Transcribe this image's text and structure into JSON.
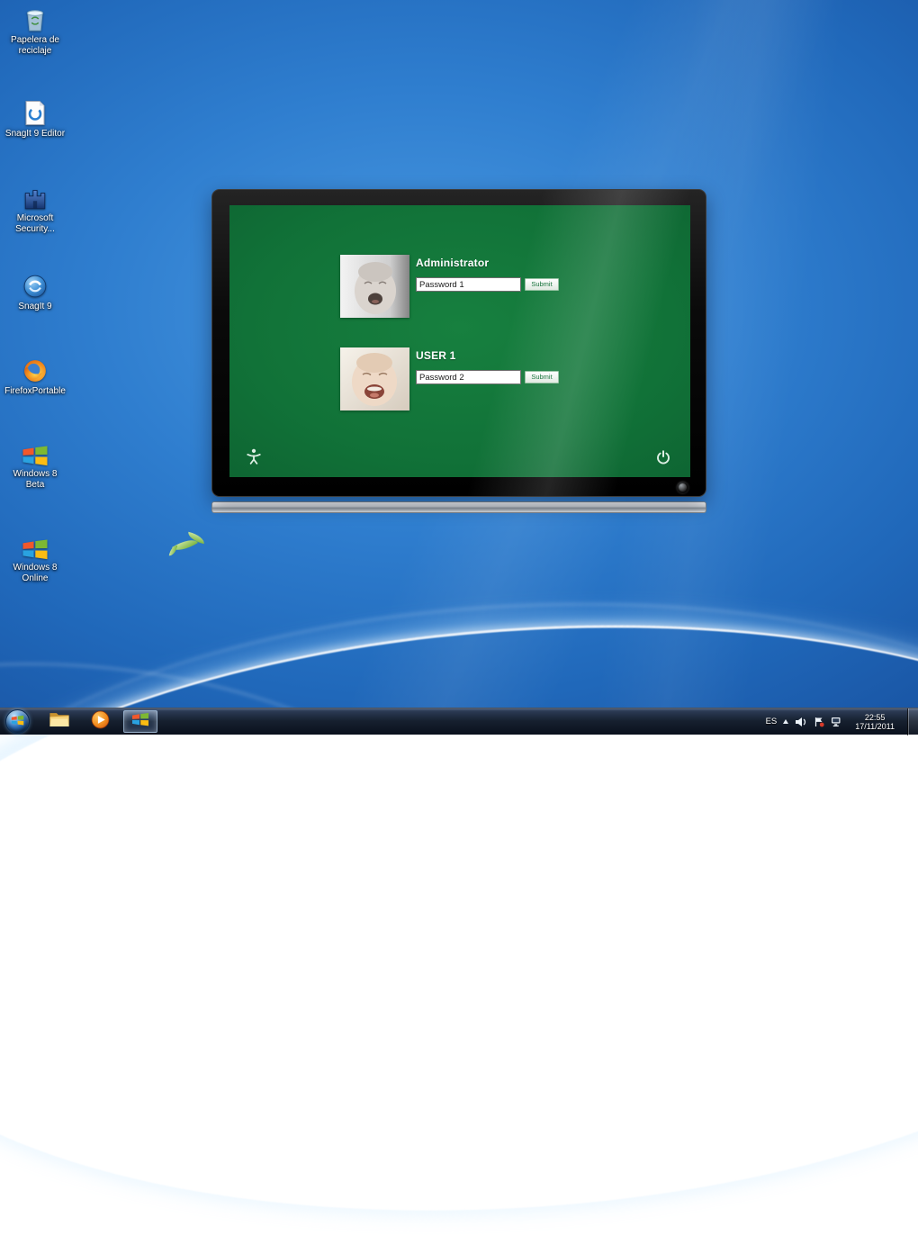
{
  "desktop_icons": [
    {
      "label": "Papelera de reciclaje",
      "icon": "recycle-bin-icon"
    },
    {
      "label": "SnagIt 9 Editor",
      "icon": "snagit-editor-icon"
    },
    {
      "label": "Microsoft Security...",
      "icon": "microsoft-security-icon"
    },
    {
      "label": "SnagIt 9",
      "icon": "snagit-icon"
    },
    {
      "label": "FirefoxPortable",
      "icon": "firefox-icon"
    },
    {
      "label": "Windows 8 Beta",
      "icon": "windows-flag-icon"
    },
    {
      "label": "Windows 8 Online",
      "icon": "windows-flag-icon"
    }
  ],
  "login": {
    "users": [
      {
        "username": "Administrator",
        "password_value": "Password 1",
        "submit_label": "Submit"
      },
      {
        "username": "USER 1",
        "password_value": "Password 2",
        "submit_label": "Submit"
      }
    ]
  },
  "taskbar": {
    "language": "ES",
    "clock": {
      "time": "22:55",
      "date": "17/11/2011"
    }
  },
  "colors": {
    "wallpaper_blue": "#2f7ecf",
    "login_green": "#117238",
    "taskbar_dark": "#16202f",
    "submit_text_green": "#0e6e34"
  }
}
